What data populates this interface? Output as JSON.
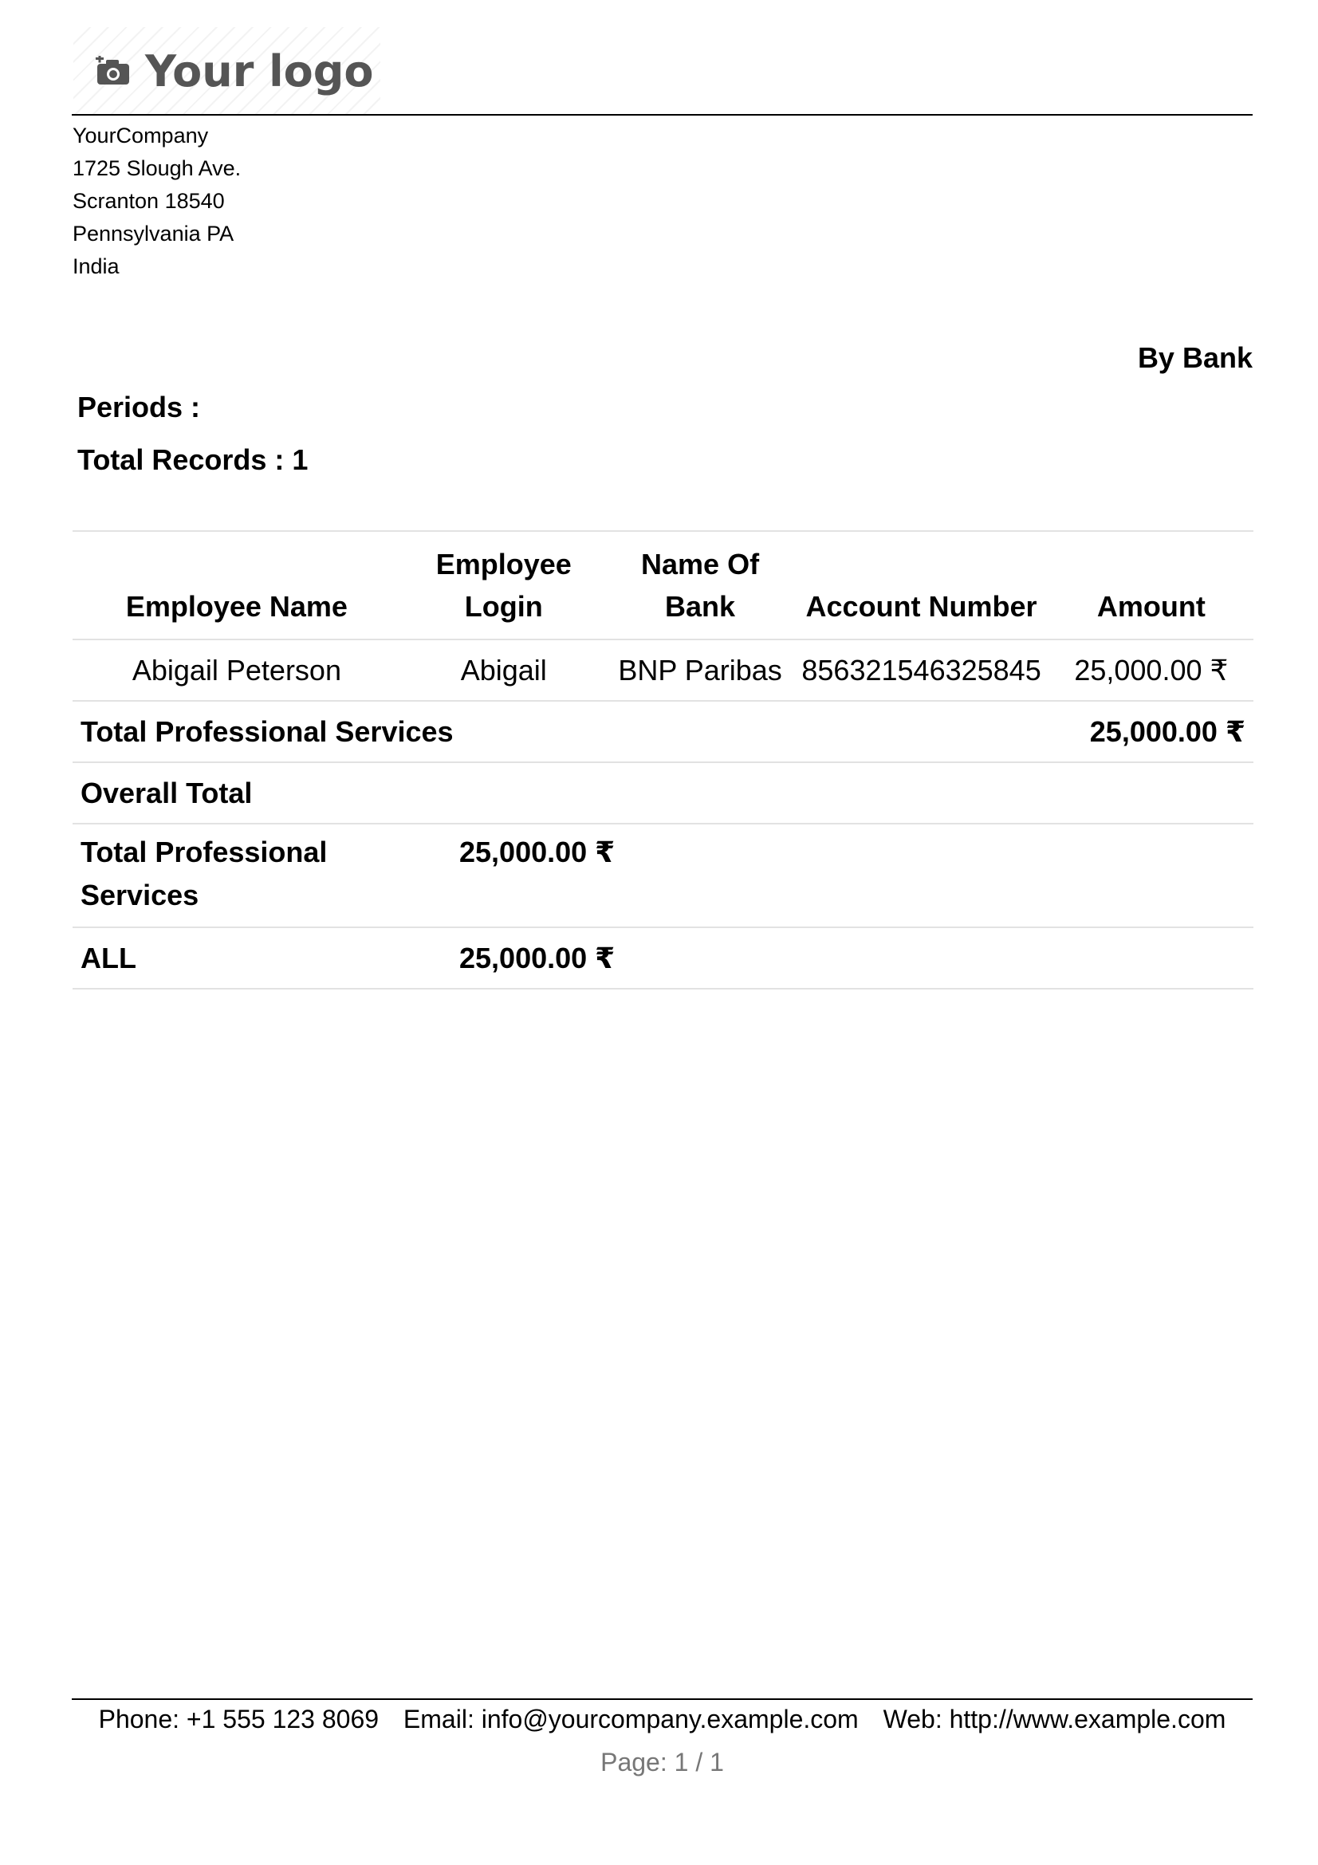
{
  "header": {
    "logo_text": "Your logo",
    "logo_icon": "camera-plus-icon",
    "company_address": [
      "YourCompany",
      "1725 Slough Ave.",
      "Scranton 18540",
      "Pennsylvania PA",
      "India"
    ]
  },
  "report": {
    "by_label": "By Bank",
    "periods_label": "Periods :",
    "total_records_label": "Total Records : 1",
    "columns": {
      "employee_name": "Employee Name",
      "employee_login_1": "Employee",
      "employee_login_2": "Login",
      "bank_name_1": "Name Of",
      "bank_name_2": "Bank",
      "account_number": "Account Number",
      "amount": "Amount"
    },
    "rows": [
      {
        "employee_name": "Abigail Peterson",
        "employee_login": "Abigail",
        "bank_name": "BNP Paribas",
        "account_number": "856321546325845",
        "amount": "25,000.00 ₹"
      }
    ],
    "subtotal": {
      "label": "Total Professional Services",
      "amount": "25,000.00 ₹"
    },
    "overall_total_label": "Overall Total",
    "summary": [
      {
        "label_1": "Total Professional",
        "label_2": "Services",
        "amount": "25,000.00 ₹"
      },
      {
        "label": "ALL",
        "amount": "25,000.00 ₹"
      }
    ]
  },
  "footer": {
    "phone": "Phone: +1 555 123 8069",
    "email": "Email: info@yourcompany.example.com",
    "web": "Web: http://www.example.com",
    "page": "Page: 1 / 1"
  },
  "colors": {
    "logo_gray": "#555555",
    "rule_gray": "#e2e2e2",
    "page_number_gray": "#777777"
  }
}
